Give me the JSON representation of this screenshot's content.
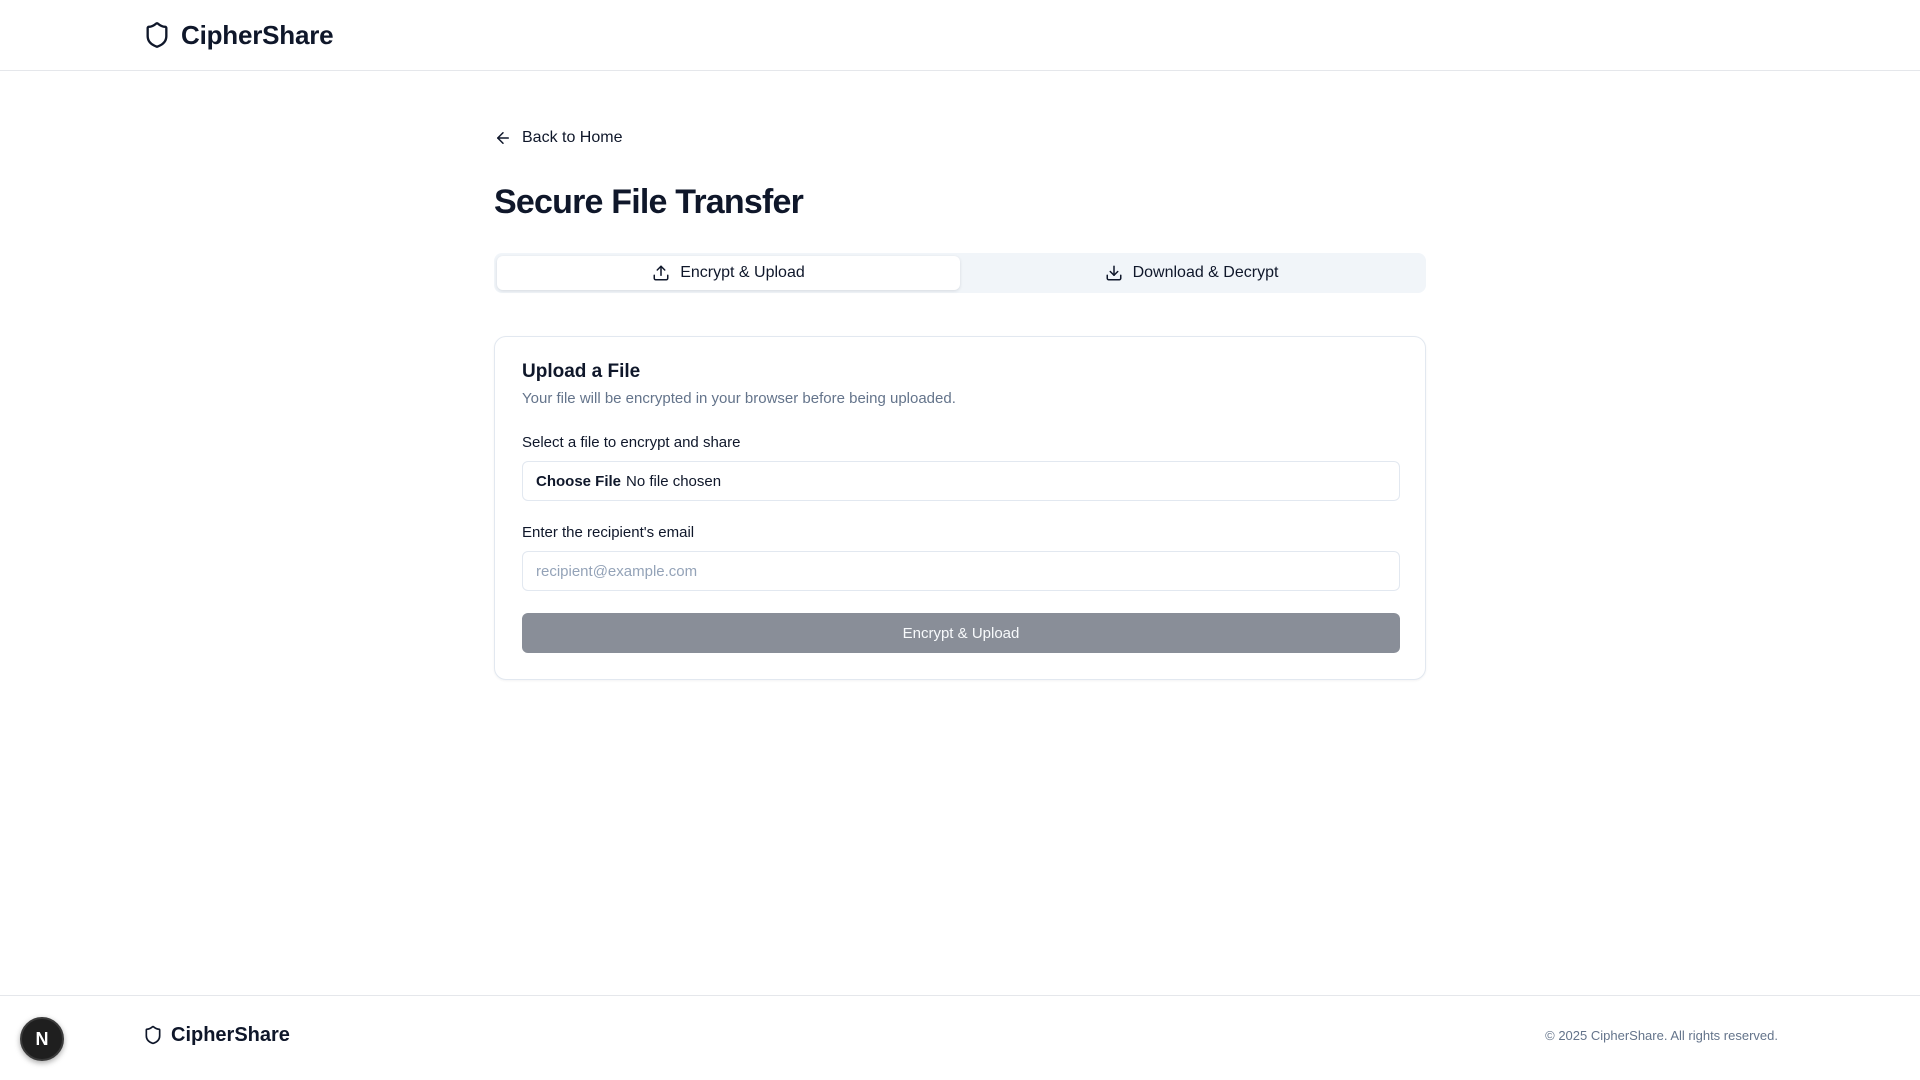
{
  "header": {
    "brand_name": "CipherShare",
    "brand_icon": "shield-icon"
  },
  "main": {
    "back_link": "Back to Home",
    "back_icon": "arrow-left-icon",
    "title": "Secure File Transfer",
    "tabs": [
      {
        "label": "Encrypt & Upload",
        "icon": "upload-icon",
        "active": true
      },
      {
        "label": "Download & Decrypt",
        "icon": "download-icon",
        "active": false
      }
    ],
    "card": {
      "title": "Upload a File",
      "description": "Your file will be encrypted in your browser before being uploaded.",
      "file_label": "Select a file to encrypt and share",
      "file_button": "Choose File",
      "file_status": "No file chosen",
      "email_label": "Enter the recipient's email",
      "email_placeholder": "recipient@example.com",
      "email_value": "",
      "submit_label": "Encrypt & Upload",
      "submit_disabled": true
    }
  },
  "footer": {
    "brand_name": "CipherShare",
    "copyright": "© 2025 CipherShare. All rights reserved."
  },
  "dev_badge": {
    "label": "N"
  },
  "colors": {
    "text": "#0f172a",
    "muted": "#64748b",
    "border": "#e2e8f0",
    "tab_bg": "#f1f5f9",
    "button_disabled": "#898e98"
  }
}
